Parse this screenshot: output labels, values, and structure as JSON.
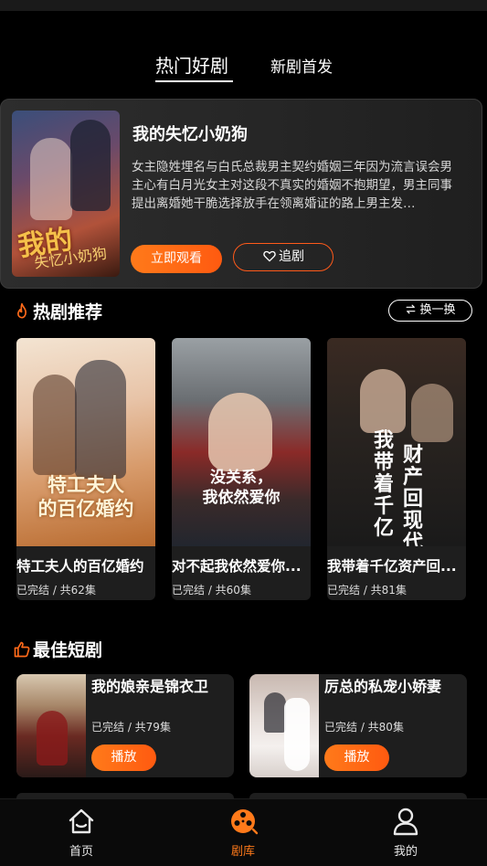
{
  "top_tabs": {
    "active": "热门好剧",
    "inactive": "新剧首发"
  },
  "featured": {
    "title": "我的失忆小奶狗",
    "description": "女主隐姓埋名与白氏总裁男主契约婚姻三年因为流言误会男主心有白月光女主对这段不真实的婚姻不抱期望，男主同事提出离婚她干脆选择放手在领离婚证的路上男主发…",
    "poster_art_title": "我的",
    "poster_art_sub": "失忆小奶狗",
    "watch_label": "立即观看",
    "follow_label": "追剧"
  },
  "hot_section": {
    "title": "热剧推荐",
    "refresh_label": "换一换",
    "items": [
      {
        "name": "特工夫人的百亿婚约",
        "meta": "已完结 / 共62集",
        "art": "特工夫人\n的百亿婚约"
      },
      {
        "name": "对不起我依然爱你...",
        "meta": "已完结 / 共60集",
        "art": "没关系，\n我依然爱你"
      },
      {
        "name": "我带着千亿资产回...",
        "meta": "已完结 / 共81集",
        "art": "我带着千亿 财产回现代"
      }
    ]
  },
  "best_section": {
    "title": "最佳短剧",
    "items": [
      {
        "name": "我的娘亲是锦衣卫",
        "meta": "已完结 / 共79集",
        "play_label": "播放"
      },
      {
        "name": "厉总的私宠小娇妻",
        "meta": "已完结 / 共80集",
        "play_label": "播放"
      }
    ]
  },
  "bottom_nav": {
    "items": [
      {
        "label": "首页",
        "icon": "home-icon"
      },
      {
        "label": "剧库",
        "icon": "film-reel-icon"
      },
      {
        "label": "我的",
        "icon": "profile-icon"
      }
    ],
    "active_color": "#ff7a1a"
  },
  "colors": {
    "accent": "#ff5a10",
    "background": "#000000",
    "card": "#1e1e1e"
  }
}
